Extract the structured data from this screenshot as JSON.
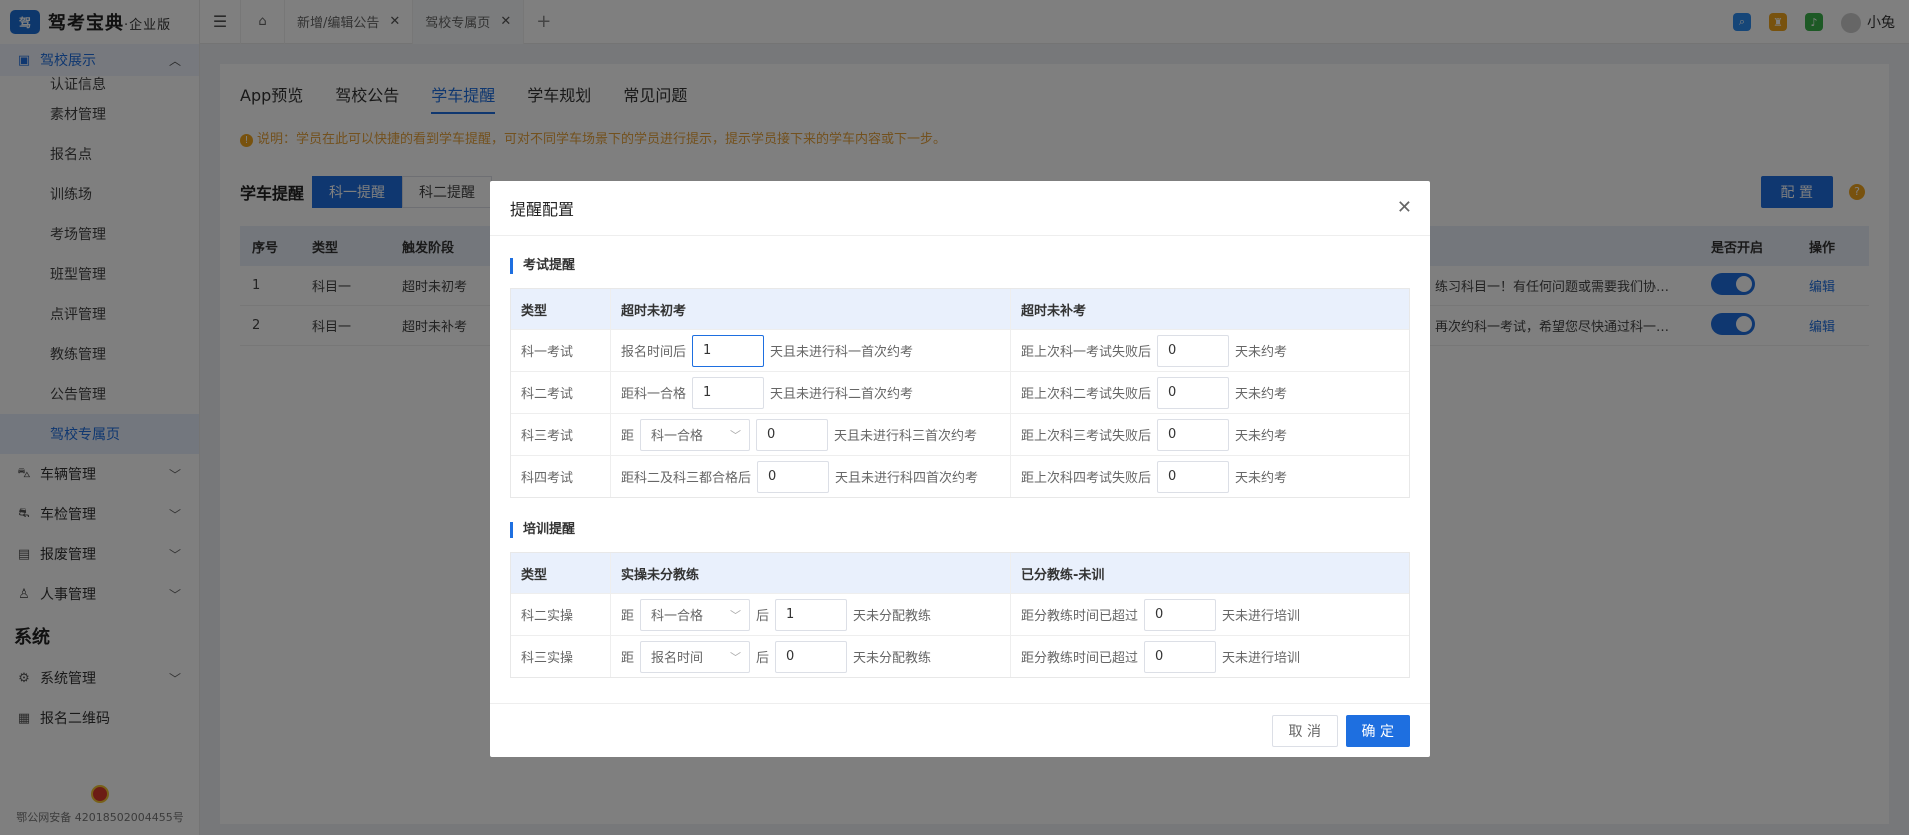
{
  "app": {
    "logo_badge": "驾",
    "name": "驾考宝典",
    "edition": "·企业版"
  },
  "sidebar": {
    "group_label": "驾校展示",
    "sub_items": [
      {
        "label": "认证信息",
        "active": false
      },
      {
        "label": "素材管理",
        "active": false
      },
      {
        "label": "报名点",
        "active": false
      },
      {
        "label": "训练场",
        "active": false
      },
      {
        "label": "考场管理",
        "active": false
      },
      {
        "label": "班型管理",
        "active": false
      },
      {
        "label": "点评管理",
        "active": false
      },
      {
        "label": "教练管理",
        "active": false
      },
      {
        "label": "公告管理",
        "active": false
      },
      {
        "label": "驾校专属页",
        "active": true
      }
    ],
    "menu_items": [
      {
        "label": "车辆管理",
        "icon": "car-icon"
      },
      {
        "label": "车检管理",
        "icon": "car-check-icon"
      },
      {
        "label": "报废管理",
        "icon": "scrap-icon"
      },
      {
        "label": "人事管理",
        "icon": "user-icon"
      }
    ],
    "section_title": "系统",
    "system_items": [
      {
        "label": "系统管理",
        "icon": "gear-icon",
        "chevron": true
      },
      {
        "label": "报名二维码",
        "icon": "qrcode-icon",
        "chevron": false
      }
    ],
    "icp": "鄂公网安备 42018502004455号"
  },
  "topbar": {
    "tabs": [
      {
        "label": "新增/编辑公告"
      },
      {
        "label": "驾校专属页"
      }
    ],
    "user_name": "小兔"
  },
  "page": {
    "tabs": [
      "App预览",
      "驾校公告",
      "学车提醒",
      "学车规划",
      "常见问题"
    ],
    "active_tab": "学车提醒",
    "notice": "说明：学员在此可以快捷的看到学车提醒，可对不同学车场景下的学员进行提示，提示学员接下来的学车内容或下一步。",
    "section_label": "学车提醒",
    "subtabs": [
      "科一提醒",
      "科二提醒"
    ],
    "config_button": "配 置",
    "table": {
      "headers": [
        "序号",
        "类型",
        "触发阶段",
        "是否开启",
        "操作"
      ],
      "rows": [
        {
          "no": "1",
          "type": "科目一",
          "stage": "超时未初考",
          "content": "练习科目一！有任何问题或需要我们协…",
          "op": "编辑"
        },
        {
          "no": "2",
          "type": "科目一",
          "stage": "超时未补考",
          "content": "再次约科一考试，希望您尽快通过科一…",
          "op": "编辑"
        }
      ]
    }
  },
  "dialog": {
    "title": "提醒配置",
    "exam": {
      "title": "考试提醒",
      "headers": [
        "类型",
        "超时未初考",
        "超时未补考"
      ],
      "rows": [
        {
          "type": "科一考试",
          "a_pre": "报名时间后",
          "a_value": "1",
          "a_post": "天且未进行科一首次约考",
          "b_pre": "距上次科一考试失败后",
          "b_value": "0",
          "b_post": "天未约考"
        },
        {
          "type": "科二考试",
          "a_pre": "距科一合格",
          "a_value": "1",
          "a_post": "天且未进行科二首次约考",
          "b_pre": "距上次科二考试失败后",
          "b_value": "0",
          "b_post": "天未约考"
        },
        {
          "type": "科三考试",
          "a_pre": "距",
          "a_select": "科一合格",
          "a_value": "0",
          "a_post": "天且未进行科三首次约考",
          "b_pre": "距上次科三考试失败后",
          "b_value": "0",
          "b_post": "天未约考"
        },
        {
          "type": "科四考试",
          "a_pre": "距科二及科三都合格后",
          "a_value": "0",
          "a_post": "天且未进行科四首次约考",
          "b_pre": "距上次科四考试失败后",
          "b_value": "0",
          "b_post": "天未约考"
        }
      ]
    },
    "training": {
      "title": "培训提醒",
      "headers": [
        "类型",
        "实操未分教练",
        "已分教练-未训"
      ],
      "rows": [
        {
          "type": "科二实操",
          "a_pre": "距",
          "a_select": "科一合格",
          "a_mid": "后",
          "a_value": "1",
          "a_post": "天未分配教练",
          "b_pre": "距分教练时间已超过",
          "b_value": "0",
          "b_post": "天未进行培训"
        },
        {
          "type": "科三实操",
          "a_pre": "距",
          "a_select": "报名时间",
          "a_mid": "后",
          "a_value": "0",
          "a_post": "天未分配教练",
          "b_pre": "距分教练时间已超过",
          "b_value": "0",
          "b_post": "天未进行培训"
        }
      ]
    },
    "cancel": "取 消",
    "ok": "确 定"
  }
}
